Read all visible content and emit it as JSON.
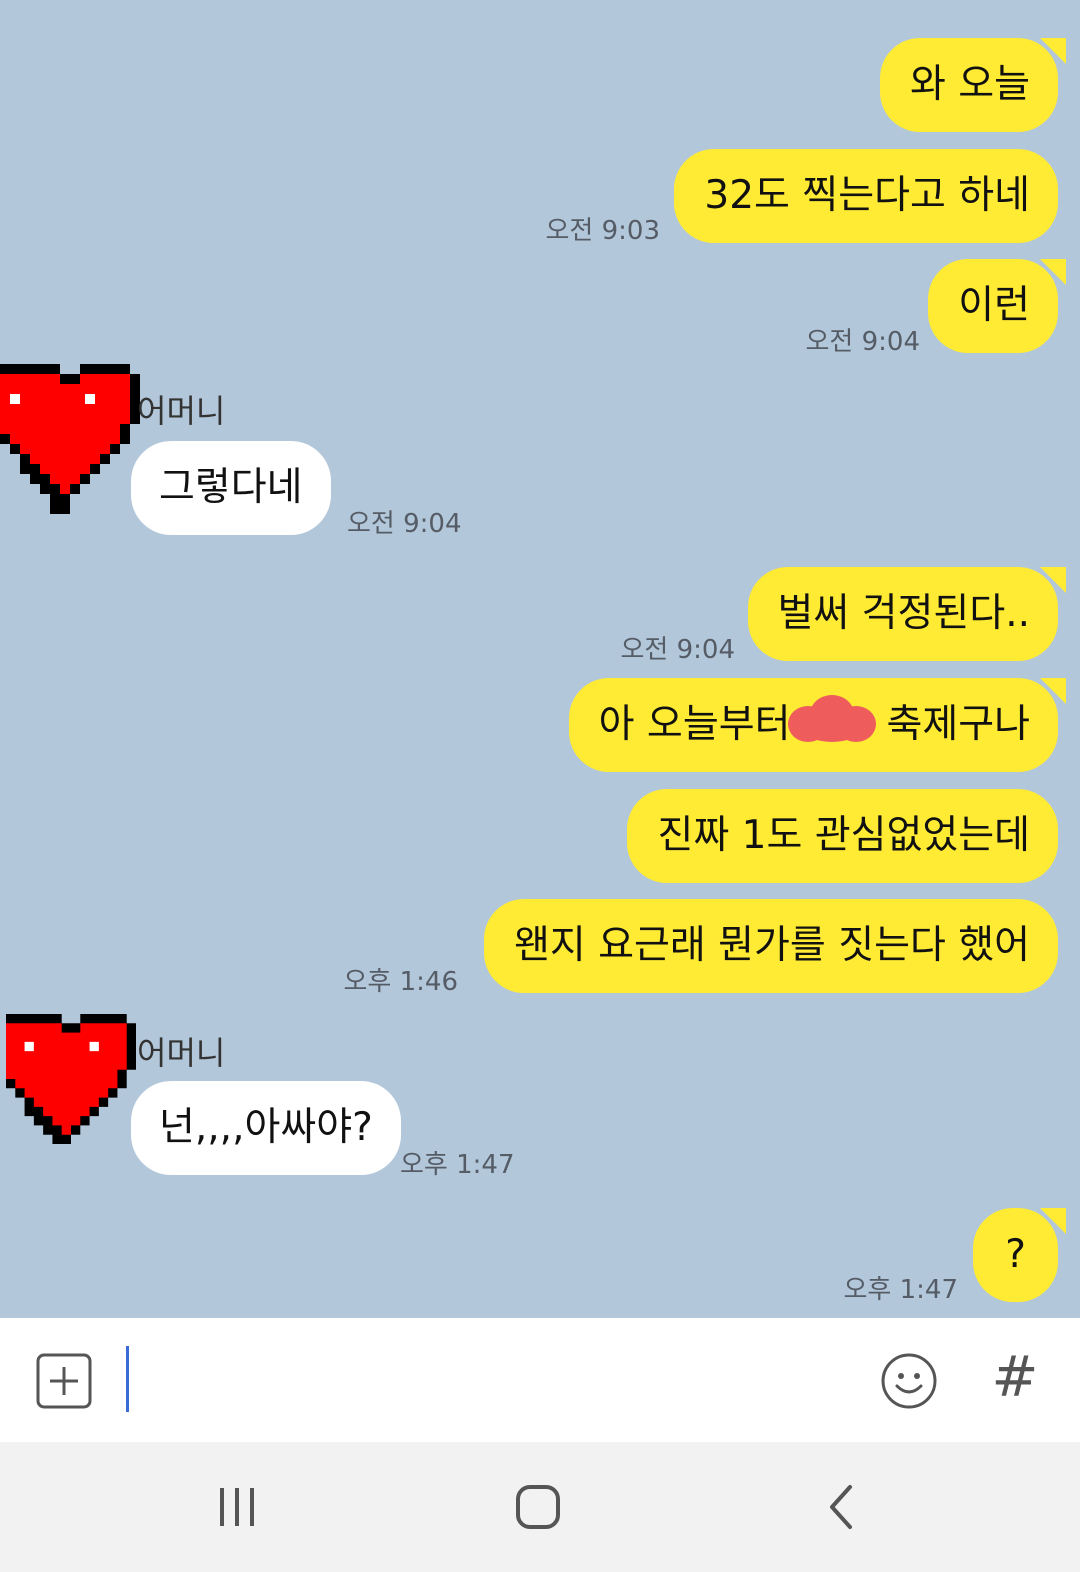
{
  "contact_name": "어머니",
  "messages": [
    {
      "from": "me",
      "text": "와 오늘",
      "time": ""
    },
    {
      "from": "me",
      "text": "32도 찍는다고 하네",
      "time": "오전 9:03"
    },
    {
      "from": "me",
      "text": "이런",
      "time": "오전 9:04"
    },
    {
      "from": "them",
      "text": "그렇다네",
      "time": "오전 9:04"
    },
    {
      "from": "me",
      "text": "벌써 걱정된다..",
      "time": "오전 9:04"
    },
    {
      "from": "me",
      "text": "아 오늘부터",
      "text_after": "축제구나",
      "time": ""
    },
    {
      "from": "me",
      "text": "진짜 1도 관심없었는데",
      "time": ""
    },
    {
      "from": "me",
      "text": "왠지 요근래 뭔가를 짓는다 했어",
      "time": "오후 1:46"
    },
    {
      "from": "them",
      "text": "넌,,,,아싸야?",
      "time": "오후 1:47"
    },
    {
      "from": "me",
      "text": "?",
      "time": "오후 1:47"
    }
  ],
  "input": {
    "placeholder": "",
    "hash_label": "#"
  },
  "colors": {
    "chat_background": "#b2c7da",
    "my_bubble": "#ffeb33",
    "their_bubble": "#ffffff",
    "avatar_heart": "#ff0000",
    "redaction_mark": "#ee5c5c"
  },
  "icons": {
    "attach": "plus-square-icon",
    "emoji": "smiley-icon",
    "nav_recents": "recent-apps-icon",
    "nav_home": "home-icon",
    "nav_back": "back-chevron-icon"
  }
}
